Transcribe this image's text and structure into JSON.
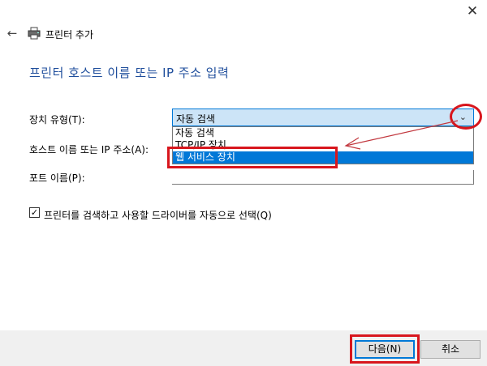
{
  "window": {
    "close_glyph": "✕",
    "back_glyph": "←"
  },
  "wizard": {
    "title": "프린터 추가"
  },
  "page": {
    "heading": "프린터 호스트 이름 또는 IP 주소 입력"
  },
  "form": {
    "device_type_label": "장치 유형(T):",
    "device_type_value": "자동 검색",
    "device_type_options": [
      "자동 검색",
      "TCP/IP 장치",
      "웹 서비스 장치"
    ],
    "hostname_label": "호스트 이름 또는 IP 주소(A):",
    "port_label": "포트 이름(P):",
    "auto_select_checkbox_label": "프린터를 검색하고 사용할 드라이버를 자동으로 선택(Q)",
    "auto_select_checked": true
  },
  "footer": {
    "next_label": "다음(N)",
    "cancel_label": "취소"
  },
  "colors": {
    "heading": "#1f4e9c",
    "selection": "#0078d7",
    "highlight_annotation": "#d8161d"
  },
  "icons": {
    "printer": "printer-icon",
    "back": "back-arrow-icon",
    "close": "close-icon",
    "dropdown": "chevron-down-icon"
  }
}
